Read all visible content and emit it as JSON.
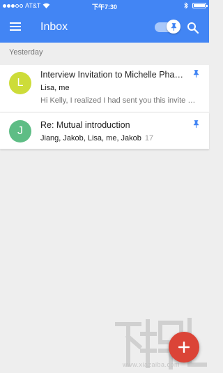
{
  "status_bar": {
    "carrier": "AT&T",
    "time": "下午7:30"
  },
  "app_bar": {
    "title": "Inbox",
    "pinned_toggle_on": true
  },
  "section": {
    "label": "Yesterday"
  },
  "threads": [
    {
      "avatar_letter": "L",
      "avatar_color": "#cddc39",
      "subject": "Interview Invitation to Michelle Pha…",
      "senders": "Lisa, me",
      "count": "",
      "snippet": "Hi Kelly, I realized I had sent you this invite w…",
      "pinned": true
    },
    {
      "avatar_letter": "J",
      "avatar_color": "#5ebd85",
      "subject": "Re: Mutual introduction",
      "senders": "Jiang, Jakob, Lisa, me, Jakob",
      "count": "17",
      "snippet": "",
      "pinned": true
    }
  ],
  "colors": {
    "primary": "#4285f4",
    "fab": "#db4437",
    "background": "#eeeeee"
  },
  "watermark": {
    "text": "www.xiazaiba.com"
  }
}
